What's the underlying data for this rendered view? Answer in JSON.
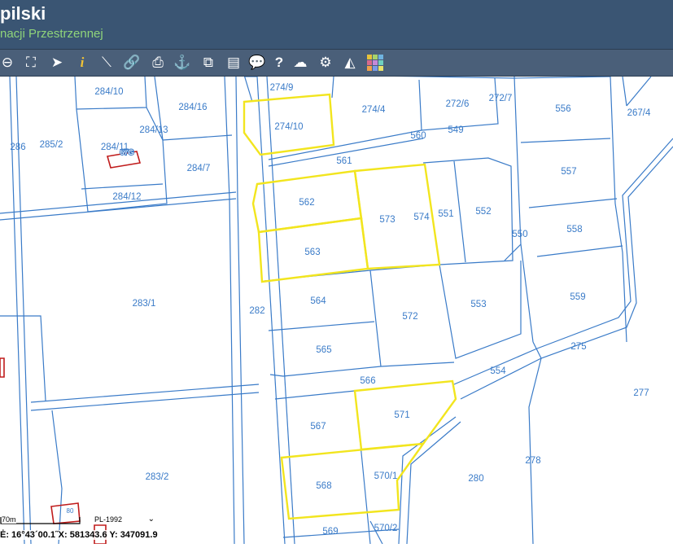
{
  "header": {
    "title": "pilski",
    "subtitle": "nacji Przestrzennej"
  },
  "toolbar": {
    "tools": [
      {
        "name": "zoom-out-icon",
        "glyph": "⊖"
      },
      {
        "name": "zoom-extent-icon",
        "glyph": "⛶"
      },
      {
        "name": "select-arrow-icon",
        "glyph": "➤"
      },
      {
        "name": "info-icon",
        "glyph": "i"
      },
      {
        "name": "measure-icon",
        "glyph": "⟍"
      },
      {
        "name": "link-icon",
        "glyph": "🔗"
      },
      {
        "name": "print-icon",
        "glyph": "⎙"
      },
      {
        "name": "pin-icon",
        "glyph": "⚓"
      },
      {
        "name": "export-icon",
        "glyph": "⧉"
      },
      {
        "name": "layout-icon",
        "glyph": "▤"
      },
      {
        "name": "comment-icon",
        "glyph": "💬"
      },
      {
        "name": "help-icon",
        "glyph": "?"
      },
      {
        "name": "cloud-upload-icon",
        "glyph": "☁"
      },
      {
        "name": "settings-icon",
        "glyph": "⚙"
      },
      {
        "name": "triangle-icon",
        "glyph": "◭"
      },
      {
        "name": "color-grid-icon",
        "glyph": "▦"
      }
    ]
  },
  "map": {
    "parcel_labels": [
      "274/9",
      "274/4",
      "272/6",
      "272/7",
      "556",
      "267/4",
      "284/10",
      "284/16",
      "274/10",
      "560",
      "549",
      "286",
      "285/2",
      "284/13",
      "284/11",
      "284/7",
      "561",
      "557",
      "284/12",
      "562",
      "573",
      "574",
      "551",
      "552",
      "558",
      "550",
      "563",
      "283/1",
      "282",
      "564",
      "572",
      "553",
      "559",
      "565",
      "275",
      "554",
      "566",
      "277",
      "567",
      "571",
      "283/2",
      "278",
      "570/1",
      "280",
      "568",
      "570/2",
      "569"
    ],
    "building_label_1": "67G",
    "building_label_2": "80"
  },
  "footer": {
    "scale": "70m",
    "crs": "PL-1992",
    "crs_arrow": "⌄",
    "coordinates": "Ė: 16°43´00.1˝X: 581343.6 Y: 347091.9"
  },
  "colors": {
    "header_bg": "#3a5573",
    "toolbar_bg": "#4a5f79",
    "parcel_line": "#3a7bc8",
    "highlight": "#f2e51e",
    "building": "#c01c1c"
  }
}
